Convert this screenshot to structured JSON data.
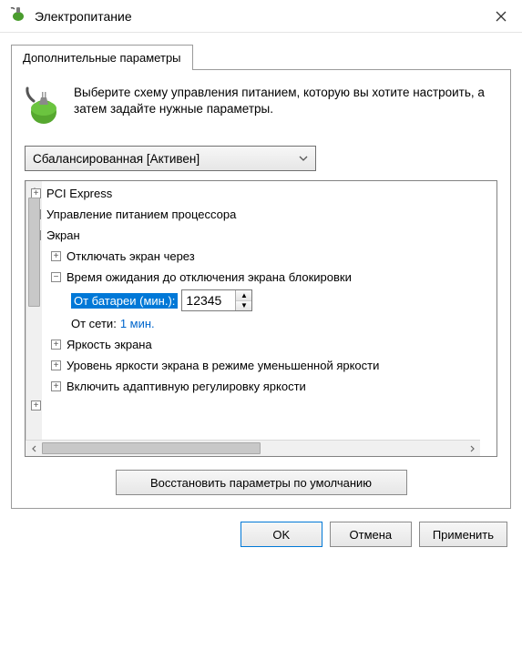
{
  "window": {
    "title": "Электропитание"
  },
  "tab": {
    "label": "Дополнительные параметры"
  },
  "instructions": "Выберите схему управления питанием, которую вы хотите настроить, а затем задайте нужные параметры.",
  "scheme": {
    "selected": "Сбалансированная [Активен]"
  },
  "tree": {
    "items": [
      {
        "label": "PCI Express"
      },
      {
        "label": "Управление питанием процессора"
      },
      {
        "label": "Экран"
      },
      {
        "label": "Отключать экран через"
      },
      {
        "label": "Время ожидания до отключения экрана блокировки"
      },
      {
        "battery_label": "От батареи (мин.):",
        "battery_value": "12345"
      },
      {
        "ac_label": "От сети:",
        "ac_value": "1 мин."
      },
      {
        "label": "Яркость экрана"
      },
      {
        "label": "Уровень яркости экрана в режиме уменьшенной яркости"
      },
      {
        "label": "Включить адаптивную регулировку яркости"
      }
    ]
  },
  "buttons": {
    "restore": "Восстановить параметры по умолчанию",
    "ok": "OK",
    "cancel": "Отмена",
    "apply": "Применить"
  }
}
